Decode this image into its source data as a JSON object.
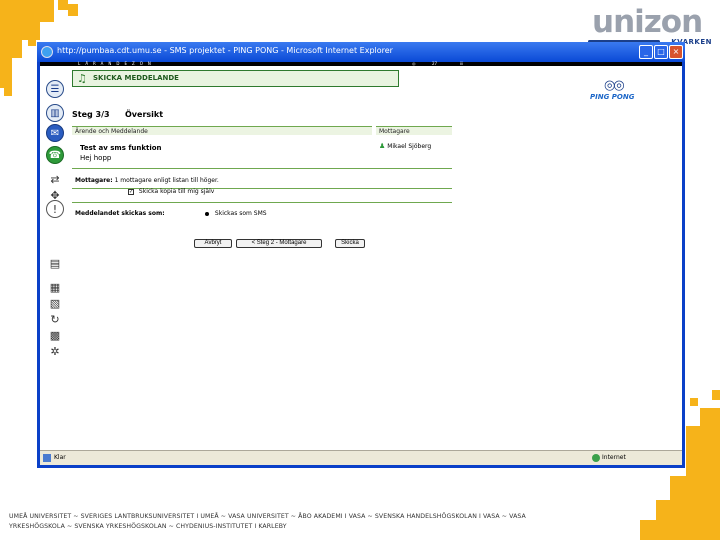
{
  "logo": {
    "word": "unizon",
    "sub": "KVARKEN"
  },
  "browser": {
    "title": "http://pumbaa.cdt.umu.se - SMS projektet - PING PONG - Microsoft Internet Explorer",
    "top_strip_label": "LÄRANDEZON",
    "top_strip_right": [
      "◎",
      "27",
      "iii"
    ],
    "status_left": "Klar",
    "status_right": "Internet"
  },
  "header": {
    "title": "SKICKA MEDDELANDE"
  },
  "pingpong": {
    "globes": "◎◎",
    "word": "PING PONG"
  },
  "step": {
    "label": "Steg 3/3",
    "overview": "Översikt"
  },
  "sections": {
    "subject_header": "Ärende och Meddelande",
    "recipients_header": "Mottagare"
  },
  "message": {
    "subject": "Test av sms funktion",
    "body": "Hej hopp"
  },
  "recipients": [
    {
      "icon": "person-icon",
      "name": "Mikael Sjöberg"
    }
  ],
  "options": {
    "mottagare_label": "Mottagare:",
    "mottagare_text": "1 mottagare enligt listan till höger.",
    "copy_checkbox": "✓",
    "copy_label": "Skicka kopia till mig själv",
    "send_as_label": "Meddelandet skickas som:",
    "send_as_value": "Skickas som SMS"
  },
  "buttons": {
    "abort": "Avbryt",
    "back": "< Steg 2 - Mottagare",
    "send": "Skicka"
  },
  "footer": "UMEÅ UNIVERSITET ~ SVERIGES LANTBRUKSUNIVERSITET I UMEÅ ~ VASA UNIVERSITET ~ ÅBO AKADEMI I VASA ~ SVENSKA HANDELSHÖGSKOLAN I VASA ~ VASA YRKESHÖGSKOLA ~ SVENSKA YRKESHÖGSKOLAN ~ CHYDENIUS-INSTITUTET I KARLEBY",
  "colors": {
    "accent_green": "#2e7a2e",
    "window_blue": "#0a40c8",
    "deco_yellow": "#f6b31a"
  }
}
